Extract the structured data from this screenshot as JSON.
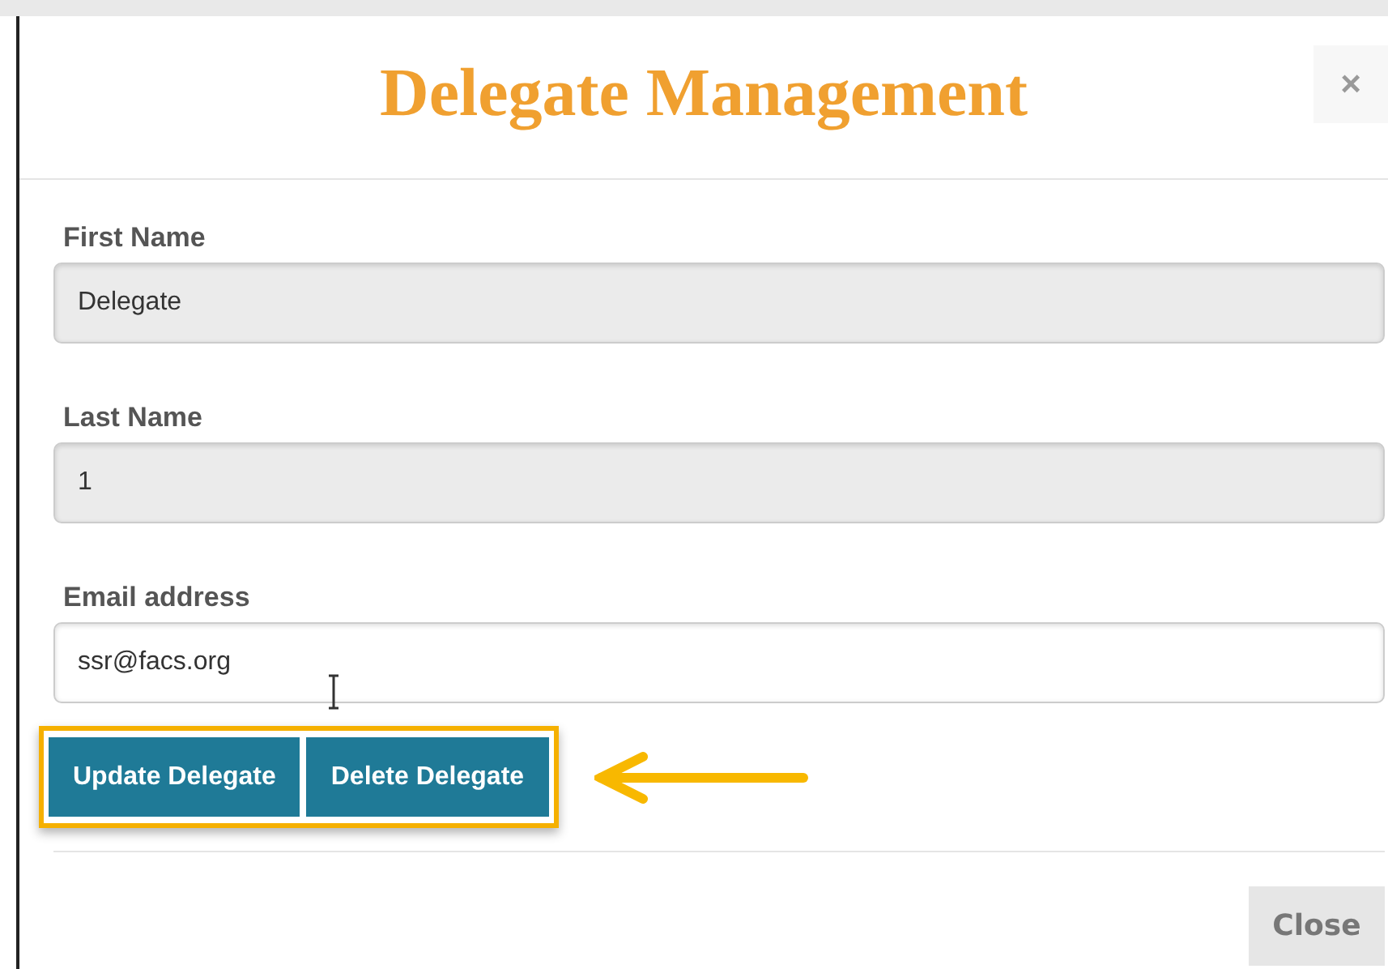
{
  "dialog": {
    "title": "Delegate Management",
    "close_symbol": "×"
  },
  "fields": [
    {
      "label": "First Name",
      "value": "Delegate",
      "disabled": true
    },
    {
      "label": "Last Name",
      "value": "1",
      "disabled": true
    },
    {
      "label": "Email address",
      "value": "ssr@facs.org",
      "disabled": false
    }
  ],
  "actions": [
    "Update Delegate",
    "Delete Delegate"
  ],
  "footer": {
    "button": "Close"
  }
}
